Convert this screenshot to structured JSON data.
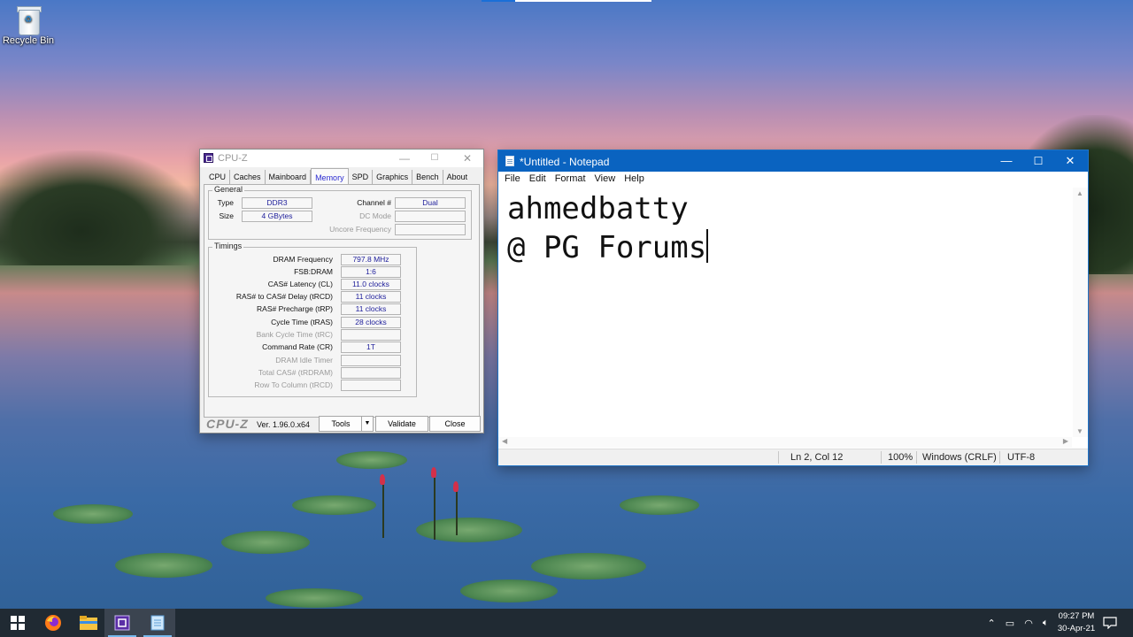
{
  "desktop": {
    "recycle_bin_label": "Recycle Bin"
  },
  "cpuz": {
    "title": "CPU-Z",
    "tabs": [
      "CPU",
      "Caches",
      "Mainboard",
      "Memory",
      "SPD",
      "Graphics",
      "Bench",
      "About"
    ],
    "active_tab": "Memory",
    "general": {
      "legend": "General",
      "type_label": "Type",
      "type_value": "DDR3",
      "size_label": "Size",
      "size_value": "4 GBytes",
      "channel_label": "Channel #",
      "channel_value": "Dual",
      "dcmode_label": "DC Mode",
      "dcmode_value": "",
      "uncore_label": "Uncore Frequency",
      "uncore_value": ""
    },
    "timings": {
      "legend": "Timings",
      "rows": [
        {
          "label": "DRAM Frequency",
          "value": "797.8 MHz",
          "enabled": true
        },
        {
          "label": "FSB:DRAM",
          "value": "1:6",
          "enabled": true
        },
        {
          "label": "CAS# Latency (CL)",
          "value": "11.0 clocks",
          "enabled": true
        },
        {
          "label": "RAS# to CAS# Delay (tRCD)",
          "value": "11 clocks",
          "enabled": true
        },
        {
          "label": "RAS# Precharge (tRP)",
          "value": "11 clocks",
          "enabled": true
        },
        {
          "label": "Cycle Time (tRAS)",
          "value": "28 clocks",
          "enabled": true
        },
        {
          "label": "Bank Cycle Time (tRC)",
          "value": "",
          "enabled": false
        },
        {
          "label": "Command Rate (CR)",
          "value": "1T",
          "enabled": true
        },
        {
          "label": "DRAM Idle Timer",
          "value": "",
          "enabled": false
        },
        {
          "label": "Total CAS# (tRDRAM)",
          "value": "",
          "enabled": false
        },
        {
          "label": "Row To Column (tRCD)",
          "value": "",
          "enabled": false
        }
      ]
    },
    "footer": {
      "logo": "CPU-Z",
      "version": "Ver. 1.96.0.x64",
      "tools_label": "Tools",
      "validate_label": "Validate",
      "close_label": "Close"
    }
  },
  "notepad": {
    "title": "*Untitled - Notepad",
    "menu": [
      "File",
      "Edit",
      "Format",
      "View",
      "Help"
    ],
    "content_line1": "ahmedbatty",
    "content_line2": "@ PG Forums",
    "status": {
      "position": "Ln 2, Col 12",
      "zoom": "100%",
      "line_ending": "Windows (CRLF)",
      "encoding": "UTF-8"
    }
  },
  "taskbar": {
    "clock_time": "09:27 PM",
    "clock_date": "30-Apr-21"
  },
  "colors": {
    "notepad_titlebar": "#0a63c0",
    "taskbar": "#202a33",
    "cpuz_value_text": "#1d1d9a"
  }
}
